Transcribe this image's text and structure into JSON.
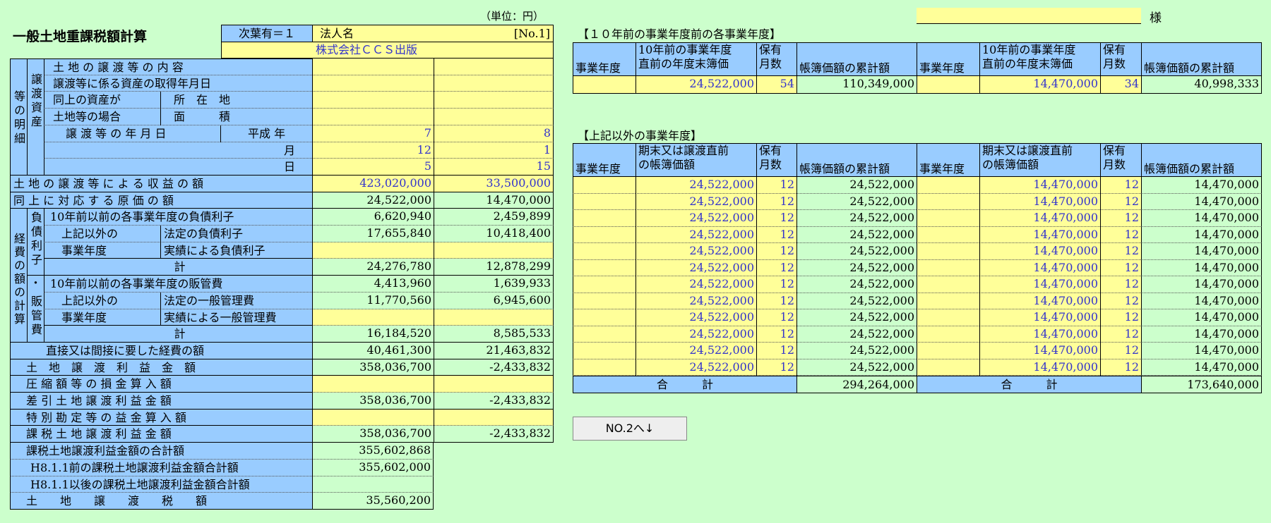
{
  "header": {
    "unit": "（単位：円）",
    "title": "一般土地重課税額計算",
    "next_flag": "次葉有＝１",
    "corp_label": "法人名",
    "page_no": "[No.1]",
    "corp_name": "株式会社ＣＣＳ出版",
    "sama": "様"
  },
  "left": {
    "group1_v1": "譲渡",
    "group1_v2": "等資",
    "group1_v3": "の明細",
    "group1_col1": "等の明細",
    "group1_col2": "譲渡資産",
    "rows": {
      "r1": "土 地 の 譲 渡 等 の 内 容",
      "r2": "譲渡等に係る資産の取得年月日",
      "r3a": "同上の資産が",
      "r3b": "土地等の場合",
      "r3c": "所　在　地",
      "r3d": "面　　　積",
      "r5": "譲 渡 等 の 年 月 日",
      "r5y": "平成 年",
      "r5m": "月",
      "r5d": "日",
      "r8": "土 地 の 譲 渡 等 に よ る 収 益 の 額",
      "r9": "同 上 に 対 応 す る 原 価 の 額",
      "k_col1": "経費の額の計算",
      "k_col2a": "負債利子",
      "k_col2b": "・",
      "k_col2c": "販管費",
      "r10": "10年前以前の各事業年度の負債利子",
      "r11a": "上記以外の",
      "r11b": "事業年度",
      "r11c": "法定の負債利子",
      "r12c": "実績による負債利子",
      "r13": "計",
      "r14": "10年前以前の各事業年度の販管費",
      "r15c": "法定の一般管理費",
      "r16c": "実績による一般管理費",
      "r17": "計",
      "r18": "直接又は間接に要した経費の額",
      "r19": "土　地　譲　渡　利　益　金　額",
      "r20": "圧 縮 額 等 の 損 金 算 入 額",
      "r21": "差 引 土 地 譲 渡 利 益 金 額",
      "r22": "特 別 勘 定 等 の 益 金 算 入 額",
      "r23": "課 税 土 地 譲 渡 利 益 金 額",
      "r24": "課税土地譲渡利益金額の合計額",
      "r25": "H8.1.1前の課税土地譲渡利益金額合計額",
      "r26": "H8.1.1以後の課税土地譲渡利益金額合計額",
      "r27": "土　　地　　譲　　渡　　税　　額"
    },
    "values": {
      "year": [
        "7",
        "8"
      ],
      "month": [
        "12",
        "1"
      ],
      "day": [
        "5",
        "15"
      ],
      "income": [
        "423,020,000",
        "33,500,000"
      ],
      "cost": [
        "24,522,000",
        "14,470,000"
      ],
      "r10": [
        "6,620,940",
        "2,459,899"
      ],
      "r11": [
        "17,655,840",
        "10,418,400"
      ],
      "r13": [
        "24,276,780",
        "12,878,299"
      ],
      "r14": [
        "4,413,960",
        "1,639,933"
      ],
      "r15": [
        "11,770,560",
        "6,945,600"
      ],
      "r17": [
        "16,184,520",
        "8,585,533"
      ],
      "r18": [
        "40,461,300",
        "21,463,832"
      ],
      "r19": [
        "358,036,700",
        "-2,433,832"
      ],
      "r21": [
        "358,036,700",
        "-2,433,832"
      ],
      "r23": [
        "358,036,700",
        "-2,433,832"
      ],
      "r24": "355,602,868",
      "r25": "355,602,000",
      "r27": "35,560,200"
    }
  },
  "right": {
    "sec1_title": "【１０年前の事業年度前の各事業年度】",
    "sec1_headers": [
      "事業年度",
      "10年前の事業年度",
      "直前の年度末簿価",
      "保有",
      "月数",
      "帳簿価額の累計額"
    ],
    "sec1_row": [
      "24,522,000",
      "54",
      "110,349,000",
      "14,470,000",
      "34",
      "40,998,333"
    ],
    "sec2_title": "【上記以外の事業年度】",
    "sec2_headers": [
      "事業年度",
      "期末又は譲渡直前",
      "の帳簿価額",
      "保有",
      "月数",
      "帳簿価額の累計額"
    ],
    "sec2_row": [
      "24,522,000",
      "12",
      "24,522,000",
      "14,470,000",
      "12",
      "14,470,000"
    ],
    "total_label": "合　　　計",
    "totals": [
      "294,264,000",
      "173,640,000"
    ]
  },
  "button": {
    "label": "NO.2へ↓"
  }
}
